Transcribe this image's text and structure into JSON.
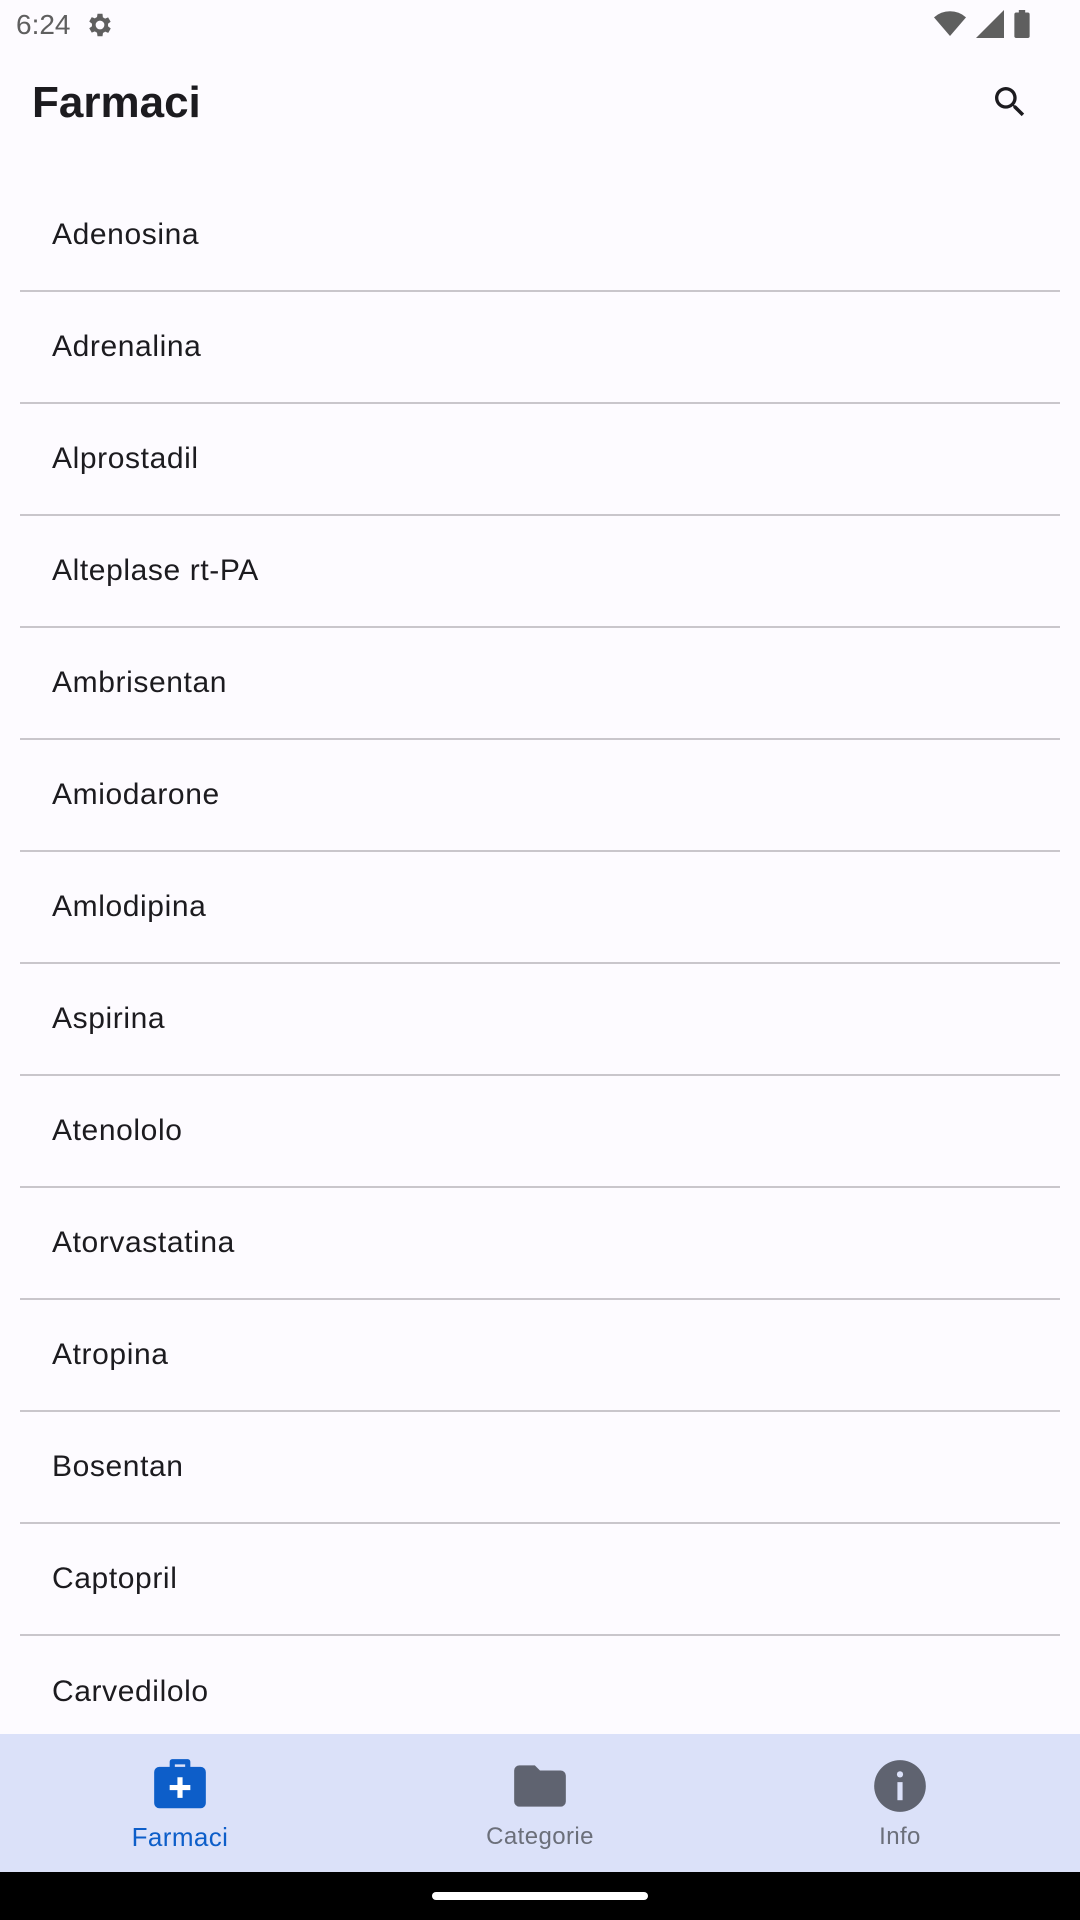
{
  "status_bar": {
    "time": "6:24",
    "icons": [
      "gear-icon",
      "wifi-icon",
      "signal-icon",
      "battery-icon"
    ]
  },
  "app_bar": {
    "title": "Farmaci",
    "search_icon": "search-icon"
  },
  "drug_list": {
    "items": [
      "Adenosina",
      "Adrenalina",
      "Alprostadil",
      "Alteplase rt-PA",
      "Ambrisentan",
      "Amiodarone",
      "Amlodipina",
      "Aspirina",
      "Atenololo",
      "Atorvastatina",
      "Atropina",
      "Bosentan",
      "Captopril",
      "Carvedilolo"
    ]
  },
  "bottom_nav": {
    "items": [
      {
        "label": "Farmaci",
        "icon": "medical-kit-icon",
        "active": true
      },
      {
        "label": "Categorie",
        "icon": "folder-icon",
        "active": false
      },
      {
        "label": "Info",
        "icon": "info-icon",
        "active": false
      }
    ]
  },
  "colors": {
    "background": "#fdfbff",
    "nav_background": "#dbe1f9",
    "accent": "#0d5ec9",
    "inactive": "#5f6370",
    "divider": "#c9c6cb"
  }
}
